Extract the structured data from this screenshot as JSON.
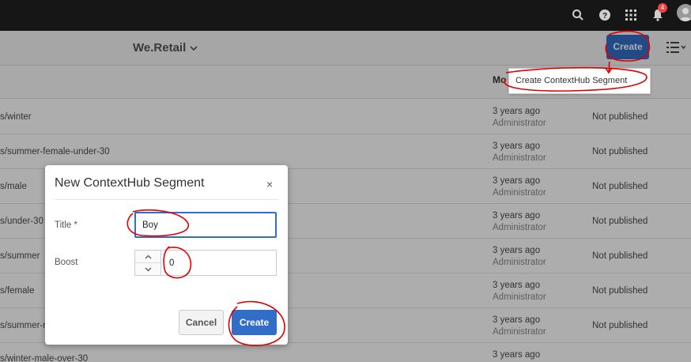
{
  "topbar": {
    "notification_count": "4"
  },
  "toolbar": {
    "brand": "We.Retail",
    "create_label": "Create"
  },
  "columns": {
    "modified": "Mo"
  },
  "dropdown": {
    "item": "Create ContextHub Segment"
  },
  "rows": [
    {
      "path": "s/winter",
      "modified": "3 years ago",
      "by": "Administrator",
      "status": "Not published"
    },
    {
      "path": "s/summer-female-under-30",
      "modified": "3 years ago",
      "by": "Administrator",
      "status": "Not published"
    },
    {
      "path": "s/male",
      "modified": "3 years ago",
      "by": "Administrator",
      "status": "Not published"
    },
    {
      "path": "s/under-30",
      "modified": "3 years ago",
      "by": "Administrator",
      "status": "Not published"
    },
    {
      "path": "s/summer",
      "modified": "3 years ago",
      "by": "Administrator",
      "status": "Not published"
    },
    {
      "path": "s/female",
      "modified": "3 years ago",
      "by": "Administrator",
      "status": "Not published"
    },
    {
      "path": "s/summer-m",
      "modified": "3 years ago",
      "by": "Administrator",
      "status": "Not published"
    },
    {
      "path": "s/winter-male-over-30",
      "modified": "3 years ago",
      "by": "",
      "status": ""
    }
  ],
  "dialog": {
    "title": "New ContextHub Segment",
    "close": "×",
    "title_label": "Title *",
    "title_value": "Boy",
    "boost_label": "Boost",
    "boost_value": "0",
    "cancel": "Cancel",
    "create": "Create"
  },
  "colors": {
    "accent": "#326ec8",
    "topbar": "#161616",
    "annotation": "#e00000"
  }
}
